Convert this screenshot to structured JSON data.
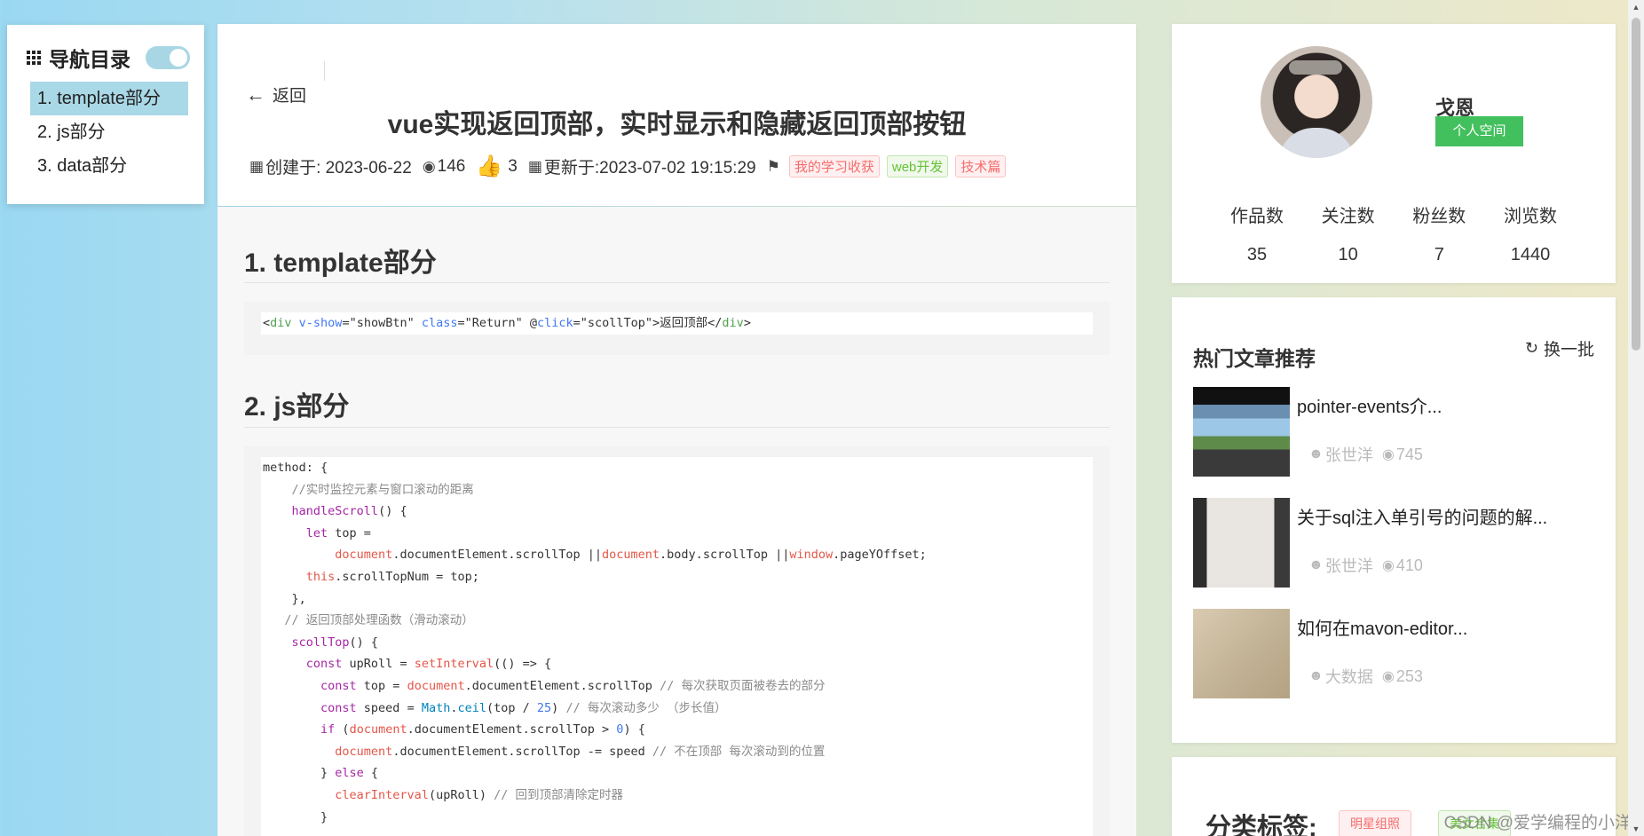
{
  "toc": {
    "title": "导航目录",
    "toggle_on": true,
    "items": [
      {
        "label": "1. template部分",
        "active": true
      },
      {
        "label": "2. js部分",
        "active": false
      },
      {
        "label": "3. data部分",
        "active": false
      }
    ]
  },
  "article": {
    "back_label": "返回",
    "title": "vue实现返回顶部，实时显示和隐藏返回顶部按钮",
    "created": "创建于: 2023-06-22",
    "views": "146",
    "likes": "3",
    "updated": "更新于:2023-07-02 19:15:29",
    "tags": [
      {
        "label": "我的学习收获",
        "color": "#f56c6c"
      },
      {
        "label": "web开发",
        "color": "#67c23a"
      },
      {
        "label": "技术篇",
        "color": "#f56c6c"
      }
    ],
    "sections": [
      {
        "heading": "1. template部分"
      },
      {
        "heading": "2. js部分"
      }
    ]
  },
  "profile": {
    "name": "戈恩",
    "space_button": "个人空间",
    "stats": [
      {
        "label": "作品数",
        "value": "35"
      },
      {
        "label": "关注数",
        "value": "10"
      },
      {
        "label": "粉丝数",
        "value": "7"
      },
      {
        "label": "浏览数",
        "value": "1440"
      }
    ]
  },
  "hot": {
    "title": "热门文章推荐",
    "refresh_label": "换一批",
    "items": [
      {
        "title": "pointer-events介...",
        "author": "张世洋",
        "views": "745"
      },
      {
        "title": "关于sql注入单引号的问题的解...",
        "author": "张世洋",
        "views": "410"
      },
      {
        "title": "如何在mavon-editor...",
        "author": "大数据",
        "views": "253"
      }
    ]
  },
  "category": {
    "title": "分类标签:",
    "tags": [
      "明星组照",
      "美女合集"
    ]
  },
  "watermark": "CSDN @爱学编程的小洋",
  "colors": {
    "toc_active": "#a9d8e6",
    "space_button": "#43c05e"
  }
}
